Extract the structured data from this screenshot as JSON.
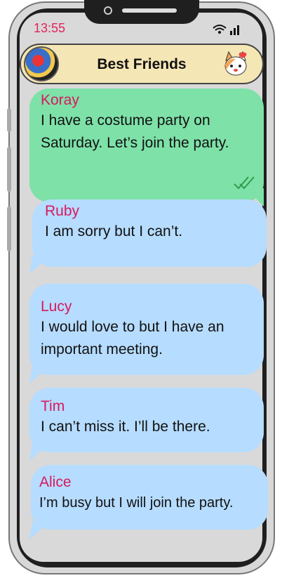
{
  "status": {
    "time": "13:55",
    "icons": "wifi-icon signal-icon"
  },
  "header": {
    "title": "Best Friends",
    "avatar": "group-avatar",
    "sticker": "cat-sticker-icon"
  },
  "messages": [
    {
      "name": "Koray",
      "text": "I have a costume party on Saturday. Let’s join the party.",
      "color": "#7ee1a8",
      "read": "double-check-icon"
    },
    {
      "name": "Ruby",
      "text": "I am sorry but I can’t.",
      "color": "#b6dcff"
    },
    {
      "name": "Lucy",
      "text": "I would love to but I have an important meeting.",
      "color": "#b6dcff"
    },
    {
      "name": "Tim",
      "text": "I can’t miss it. I’ll be there.",
      "color": "#b6dcff"
    },
    {
      "name": "Alice",
      "text": "I’m busy but I will join the party.",
      "color": "#b6dcff"
    }
  ],
  "colors": {
    "name_color": "#d7195f",
    "time_color": "#e0245e"
  }
}
